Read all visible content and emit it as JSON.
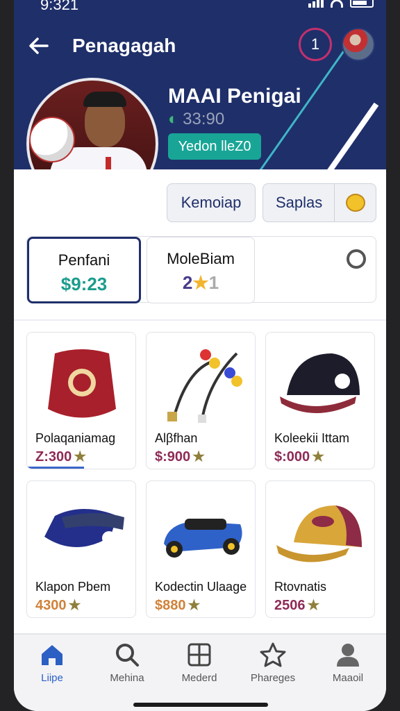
{
  "status": {
    "time": "9:321"
  },
  "header": {
    "title": "Penagagah",
    "notification_count": "1"
  },
  "player": {
    "name": "MAAI Penigai",
    "stat": "33:90",
    "team": "Yedon lleZ0"
  },
  "actions": {
    "primary": "Kemoiap",
    "secondary": "Saplas"
  },
  "stats": {
    "card1_label": "Penfani",
    "card1_value": "$9:23",
    "card2_label": "MoleBiam",
    "card2_value": "2",
    "card2_suffix": "1"
  },
  "items": [
    {
      "label": "Polaqaniamag",
      "price": "Z:300",
      "price_color": "#8e2b56",
      "icon": "red-bucket-hat"
    },
    {
      "label": "Alβfhan",
      "price": "$:900",
      "price_color": "#8e2b56",
      "icon": "earphones"
    },
    {
      "label": "Koleekii Ittam",
      "price": "$:000",
      "price_color": "#8e2b56",
      "icon": "black-cap"
    },
    {
      "label": "Klapon Ρbem",
      "price": "4300",
      "price_color": "#d0823a",
      "icon": "navy-visor"
    },
    {
      "label": "Kodectin Ulaage",
      "price": "$880",
      "price_color": "#d0823a",
      "icon": "toy-car"
    },
    {
      "label": "Rtovnatis",
      "price": "2506",
      "price_color": "#8e2b56",
      "icon": "yellow-cap"
    }
  ],
  "tabbar": {
    "tabs": [
      {
        "label": "Liipe",
        "icon": "home-icon",
        "active": true
      },
      {
        "label": "Mehina",
        "icon": "search-icon",
        "active": false
      },
      {
        "label": "Mederd",
        "icon": "grid-icon",
        "active": false
      },
      {
        "label": "Phareges",
        "icon": "star-icon",
        "active": false
      },
      {
        "label": "Maaoil",
        "icon": "person-icon",
        "active": false
      }
    ]
  },
  "colors": {
    "header_bg": "#1f2f6a",
    "teal": "#18a596",
    "active_tab": "#2c5fc4"
  }
}
